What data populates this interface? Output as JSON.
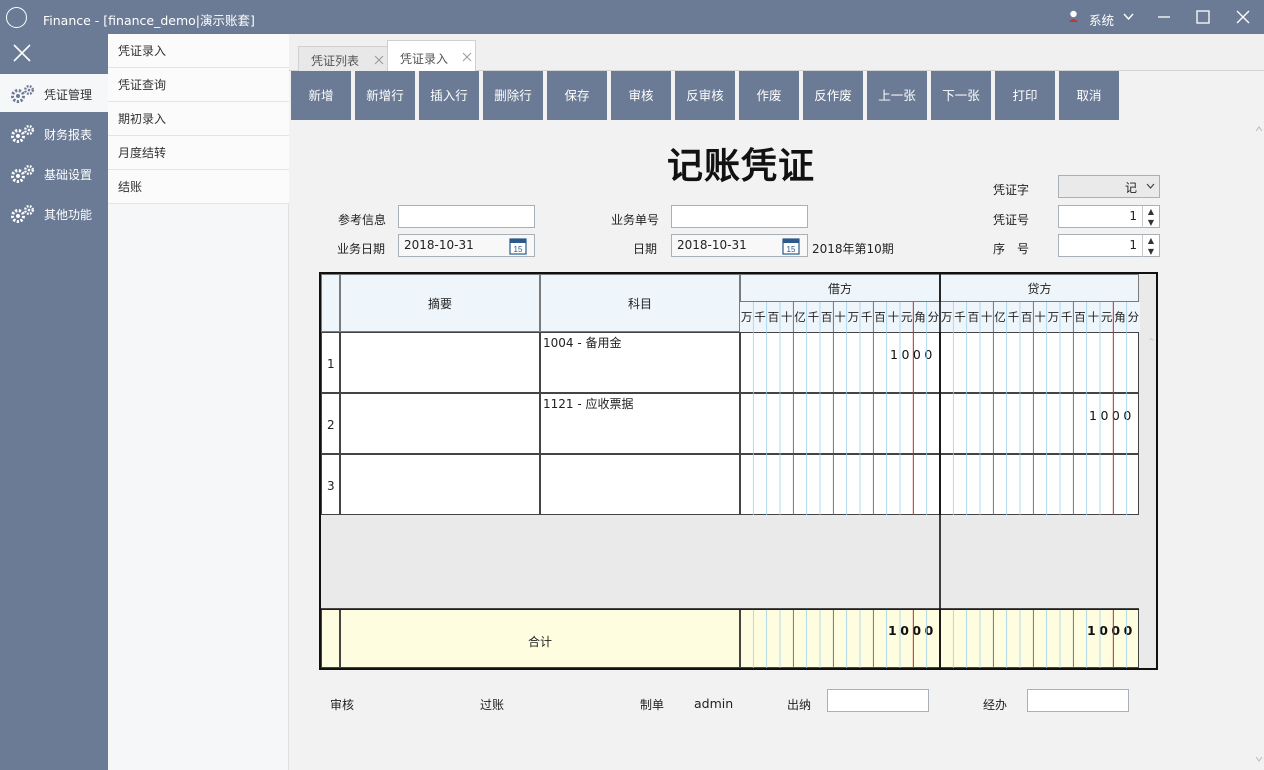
{
  "window": {
    "title": "Finance - [finance_demo|演示账套]",
    "system_menu": "系统"
  },
  "left_nav": {
    "items": [
      {
        "label": "凭证管理",
        "active": true
      },
      {
        "label": "财务报表"
      },
      {
        "label": "基础设置"
      },
      {
        "label": "其他功能"
      }
    ]
  },
  "sub_menu": {
    "items": [
      "凭证录入",
      "凭证查询",
      "期初录入",
      "月度结转",
      "结账"
    ]
  },
  "tabs": [
    {
      "label": "凭证列表"
    },
    {
      "label": "凭证录入",
      "active": true
    }
  ],
  "toolbar": {
    "buttons": [
      "新增",
      "新增行",
      "插入行",
      "删除行",
      "保存",
      "审核",
      "反审核",
      "作废",
      "反作废",
      "上一张",
      "下一张",
      "打印",
      "取消"
    ]
  },
  "voucher": {
    "title": "记账凭证",
    "ref_info_label": "参考信息",
    "ref_info_value": "",
    "biz_no_label": "业务单号",
    "biz_no_value": "",
    "biz_date_label": "业务日期",
    "biz_date_value": "2018-10-31",
    "date_label": "日期",
    "date_value": "2018-10-31",
    "calendar_day": "15",
    "period_text": "2018年第10期",
    "voucher_word_label": "凭证字",
    "voucher_word_value": "记",
    "voucher_no_label": "凭证号",
    "voucher_no_value": "1",
    "seq_label": "序　号",
    "seq_value": "1"
  },
  "grid": {
    "col_summary": "摘要",
    "col_subject": "科目",
    "col_debit": "借方",
    "col_credit": "贷方",
    "digit_units": [
      "万",
      "千",
      "百",
      "十",
      "亿",
      "千",
      "百",
      "十",
      "万",
      "千",
      "百",
      "十",
      "元",
      "角",
      "分"
    ],
    "rows": [
      {
        "no": "1",
        "subject": "1004 - 备用金",
        "debit": "1000",
        "credit": ""
      },
      {
        "no": "2",
        "subject": "1121 - 应收票据",
        "debit": "",
        "credit": "1000"
      },
      {
        "no": "3",
        "subject": "",
        "debit": "",
        "credit": ""
      }
    ],
    "total_label": "合计",
    "total_debit": "1000",
    "total_credit": "1000"
  },
  "footer": {
    "audit_label": "审核",
    "post_label": "过账",
    "maker_label": "制单",
    "maker_value": "admin",
    "cashier_label": "出纳",
    "cashier_value": "",
    "handler_label": "经办",
    "handler_value": ""
  },
  "colors": {
    "chrome": "#6b7b95",
    "grid_header": "#eef5fb",
    "total_row": "#fffde0",
    "yuan_line": "#cc2222",
    "minor_line": "#9fd0ea"
  }
}
